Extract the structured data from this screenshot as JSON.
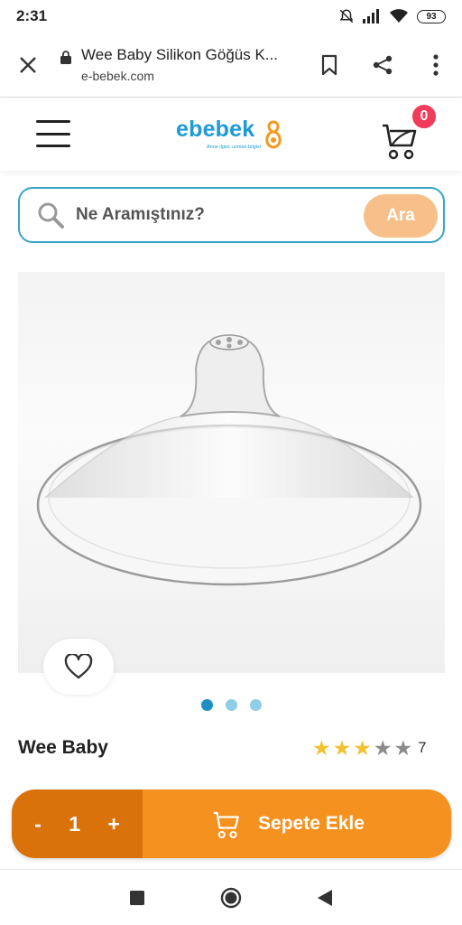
{
  "status_bar": {
    "time": "2:31",
    "battery": "93"
  },
  "browser": {
    "page_title": "Wee Baby Silikon Göğüs K...",
    "url": "e-bebek.com"
  },
  "site": {
    "logo_text": "ebebek",
    "logo_tagline": "Anne ilgisi, uzman bilgisi",
    "cart_count": "0",
    "brand_color": "#1e9ad6"
  },
  "search": {
    "placeholder": "Ne Aramıştınız?",
    "button_label": "Ara"
  },
  "product": {
    "brand": "Wee Baby",
    "rating": 3,
    "rating_max": 5,
    "review_count": "7",
    "image_dots": 3,
    "active_dot": 0
  },
  "cart_bar": {
    "minus": "-",
    "quantity": "1",
    "plus": "+",
    "add_label": "Sepete Ekle",
    "qty_color": "#d9720b",
    "button_color": "#f5911f"
  }
}
